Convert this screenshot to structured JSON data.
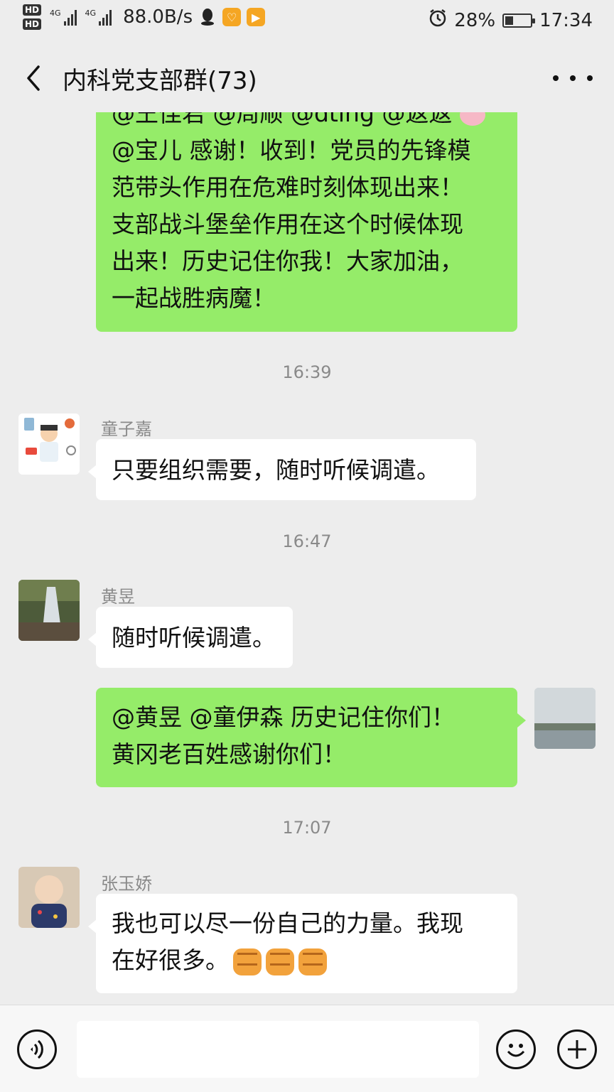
{
  "status_bar": {
    "hd1": "HD",
    "hd2": "HD",
    "net1": "4G",
    "net2": "4G",
    "speed": "88.0B/s",
    "battery": "28%",
    "time": "17:34"
  },
  "header": {
    "title": "内科党支部群(73)"
  },
  "messages": {
    "m1": {
      "lines": [
        "@王佳君 @周顺 @dting @返返",
        "@宝儿  感谢！收到！党员的先锋模",
        "范带头作用在危难时刻体现出来！",
        "支部战斗堡垒作用在这个时候体现",
        "出来！历史记住你我！大家加油，",
        "一起战胜病魔！"
      ]
    },
    "t1": "16:39",
    "m2": {
      "sender": "童子嘉",
      "lines": [
        "只要组织需要，随时听候调遣。"
      ]
    },
    "t2": "16:47",
    "m3": {
      "sender": "黄昱",
      "lines": [
        "随时听候调遣。"
      ]
    },
    "m4": {
      "lines": [
        "@黄昱  @童伊森  历史记住你们！",
        "黄冈老百姓感谢你们！"
      ]
    },
    "t3": "17:07",
    "m5": {
      "sender": "张玉娇",
      "lines": [
        "我也可以尽一份自己的力量。我现",
        "在好很多。"
      ]
    }
  },
  "colors": {
    "background": "#ededed",
    "green_bubble": "#95ec69",
    "white_bubble": "#ffffff",
    "meta_text": "#8a8a8a"
  },
  "icons": [
    "back-icon",
    "more-icon",
    "voice-icon",
    "emoji-icon",
    "plus-icon",
    "fist-emoji-icon",
    "pig-emoji-icon",
    "alarm-icon",
    "battery-icon",
    "qq-icon"
  ]
}
